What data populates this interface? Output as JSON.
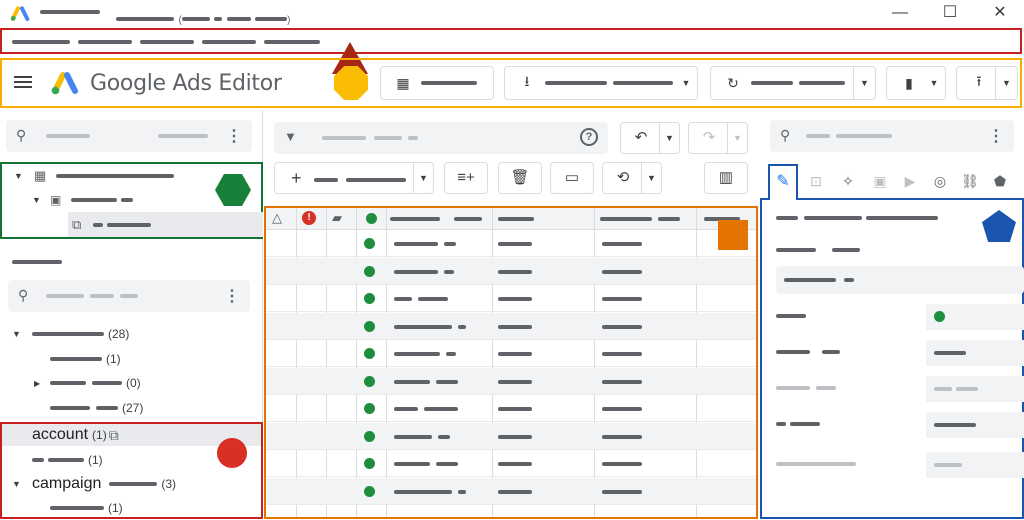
{
  "window": {
    "minimize_icon": "minimize-icon",
    "maximize_icon": "maximize-icon",
    "close_icon": "close-icon",
    "minimize_glyph": "—",
    "maximize_glyph": "☐",
    "close_glyph": "✕"
  },
  "toolbar": {
    "menu_icon": "menu-icon",
    "app_name": "Google Ads Editor",
    "buttons": [
      {
        "icon": "grid-icon",
        "glyph": "▦"
      },
      {
        "icon": "download-icon",
        "glyph": "⭳"
      },
      {
        "icon": "refresh-icon",
        "glyph": "↻"
      },
      {
        "icon": "bar-chart-icon",
        "glyph": "▮"
      },
      {
        "icon": "upload-icon",
        "glyph": "⭱"
      }
    ]
  },
  "left_panel": {
    "tree_counts": [
      "(28)",
      "(1)",
      "(0)",
      "(27)"
    ],
    "account_item": {
      "label": "account",
      "count": "(1)"
    },
    "account_child_count": "(1)",
    "campaign_item": {
      "label": "campaign",
      "count": "(3)"
    },
    "campaign_child_count": "(1)"
  },
  "center": {
    "filter_icon": "filter-icon",
    "help_glyph": "?",
    "undo_glyph": "↶",
    "redo_glyph": "↷",
    "add_glyph": "+",
    "row_count": 10
  },
  "right_panel": {
    "edit_glyph": "✎"
  },
  "colors": {
    "annotation_red": "#c5221f",
    "annotation_yellow": "#f9ab00",
    "annotation_green": "#137333",
    "annotation_orange": "#e37400",
    "annotation_blue": "#1a56b0",
    "status_green": "#1e8e3e",
    "error_red": "#d93025"
  }
}
